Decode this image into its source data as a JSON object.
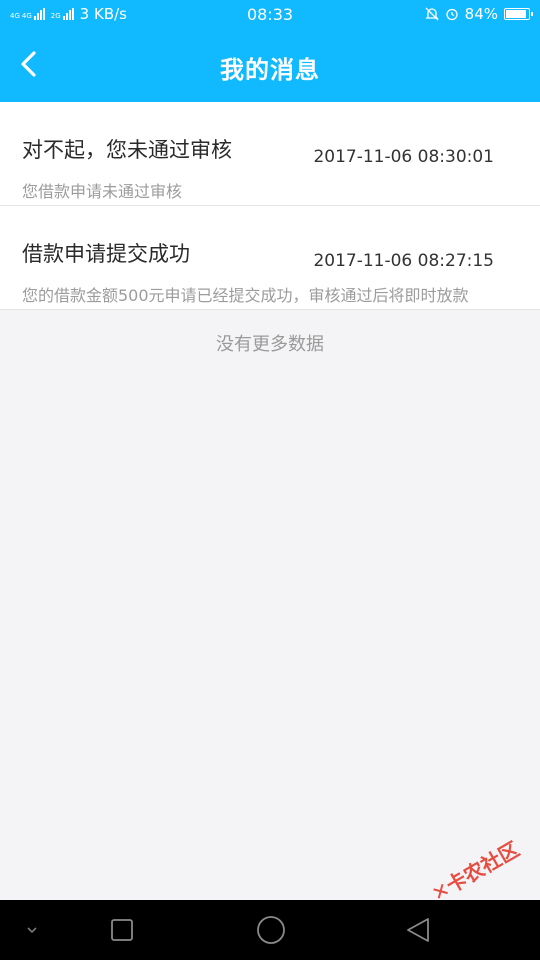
{
  "status_bar": {
    "network_labels": [
      "4G",
      "4G",
      "2G"
    ],
    "speed": "3 KB/s",
    "time": "08:33",
    "battery": "84%",
    "battery_level": 0.84
  },
  "header": {
    "title": "我的消息",
    "background_color": "#11b9ff"
  },
  "messages": [
    {
      "title": "对不起，您未通过审核",
      "time": "2017-11-06 08:30:01",
      "summary": "您借款申请未通过审核"
    },
    {
      "title": "借款申请提交成功",
      "time": "2017-11-06 08:27:15",
      "summary": "您的借款金额500元申请已经提交成功，审核通过后将即时放款"
    }
  ],
  "footer_text": "没有更多数据",
  "watermark_text": "卡农社区",
  "nav_bar": {
    "icons": [
      "chevron-down-icon",
      "square-icon",
      "circle-icon",
      "triangle-back-icon"
    ]
  }
}
